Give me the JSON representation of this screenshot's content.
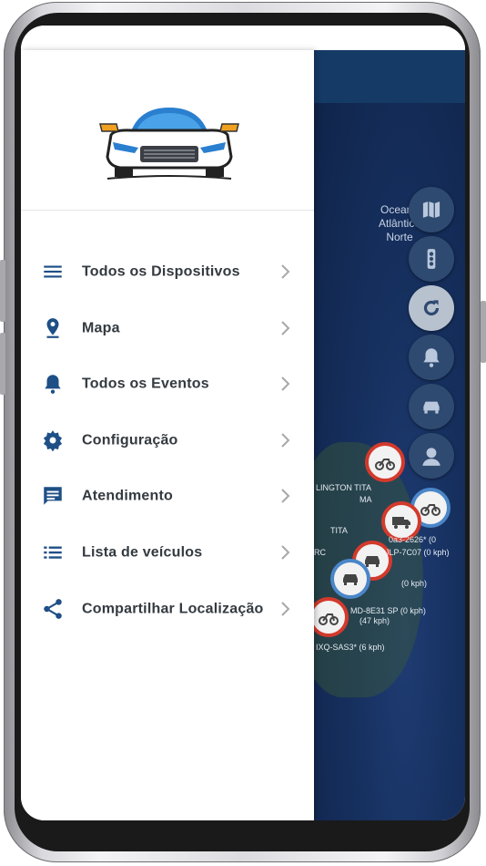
{
  "map": {
    "label_ocean": "Oceano\nAtlântico\nNorte",
    "plates": [
      "LINGTON TITA",
      "MA",
      "TITA",
      "RC",
      "JLP-7C07 (0 kph)",
      "(0 kph)",
      "MD-8E31 SP (0 kph)",
      "(47 kph)",
      "IXQ-SAS3* (6 kph)",
      "0a3-2626* (0"
    ],
    "controls": [
      "map-icon",
      "traffic-light-icon",
      "refresh-icon",
      "bell-icon",
      "car-icon",
      "driver-icon"
    ]
  },
  "drawer": {
    "menu": [
      {
        "label": "Todos os Dispositivos",
        "icon": "list-icon"
      },
      {
        "label": "Mapa",
        "icon": "location-pin-icon"
      },
      {
        "label": "Todos os Eventos",
        "icon": "bell-icon"
      },
      {
        "label": "Configuração",
        "icon": "gear-icon"
      },
      {
        "label": "Atendimento",
        "icon": "chat-icon"
      },
      {
        "label": "Lista de veículos",
        "icon": "bulleted-list-icon"
      },
      {
        "label": "Compartilhar Localização",
        "icon": "share-icon"
      }
    ]
  },
  "colors": {
    "icon": "#1e4f86",
    "text": "#333a40",
    "map_bg": "#16305f",
    "marker_red": "#d33a2c"
  }
}
